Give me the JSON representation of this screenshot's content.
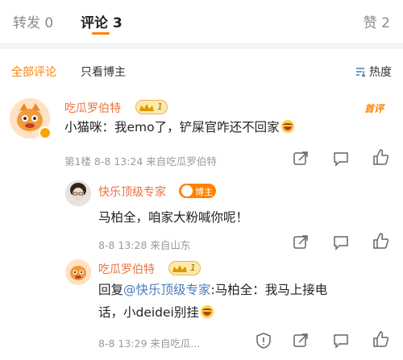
{
  "tabs": {
    "repost": "转发 0",
    "comment": "评论 3",
    "like": "赞 2"
  },
  "filter": {
    "all": "全部评论",
    "owner_only": "只看博主",
    "sort": "热度"
  },
  "comments": [
    {
      "user": "吃瓜罗伯特",
      "badge_level": "1",
      "tag": "首评",
      "text": "小猫咪：我emo了，铲屎官咋还不回家",
      "meta": "第1楼  8-8 13:24  来自吃瓜罗伯特",
      "replies": [
        {
          "user": "快乐顶级专家",
          "badge": "博主",
          "text": "马柏全，咱家大粉喊你呢！",
          "meta": "8-8 13:28  来自山东"
        },
        {
          "user": "吃瓜罗伯特",
          "badge_level": "1",
          "reply_prefix": "回复",
          "mention": "@快乐顶级专家",
          "text_line1_rest": ":马柏全：我马上接电",
          "text_line2": "话，小deidei别挂",
          "meta": "8-8 13:29  来自吃瓜..."
        }
      ]
    }
  ],
  "colors": {
    "accent": "#ff8200",
    "username": "#eb7340",
    "mention": "#4a7bbf"
  }
}
